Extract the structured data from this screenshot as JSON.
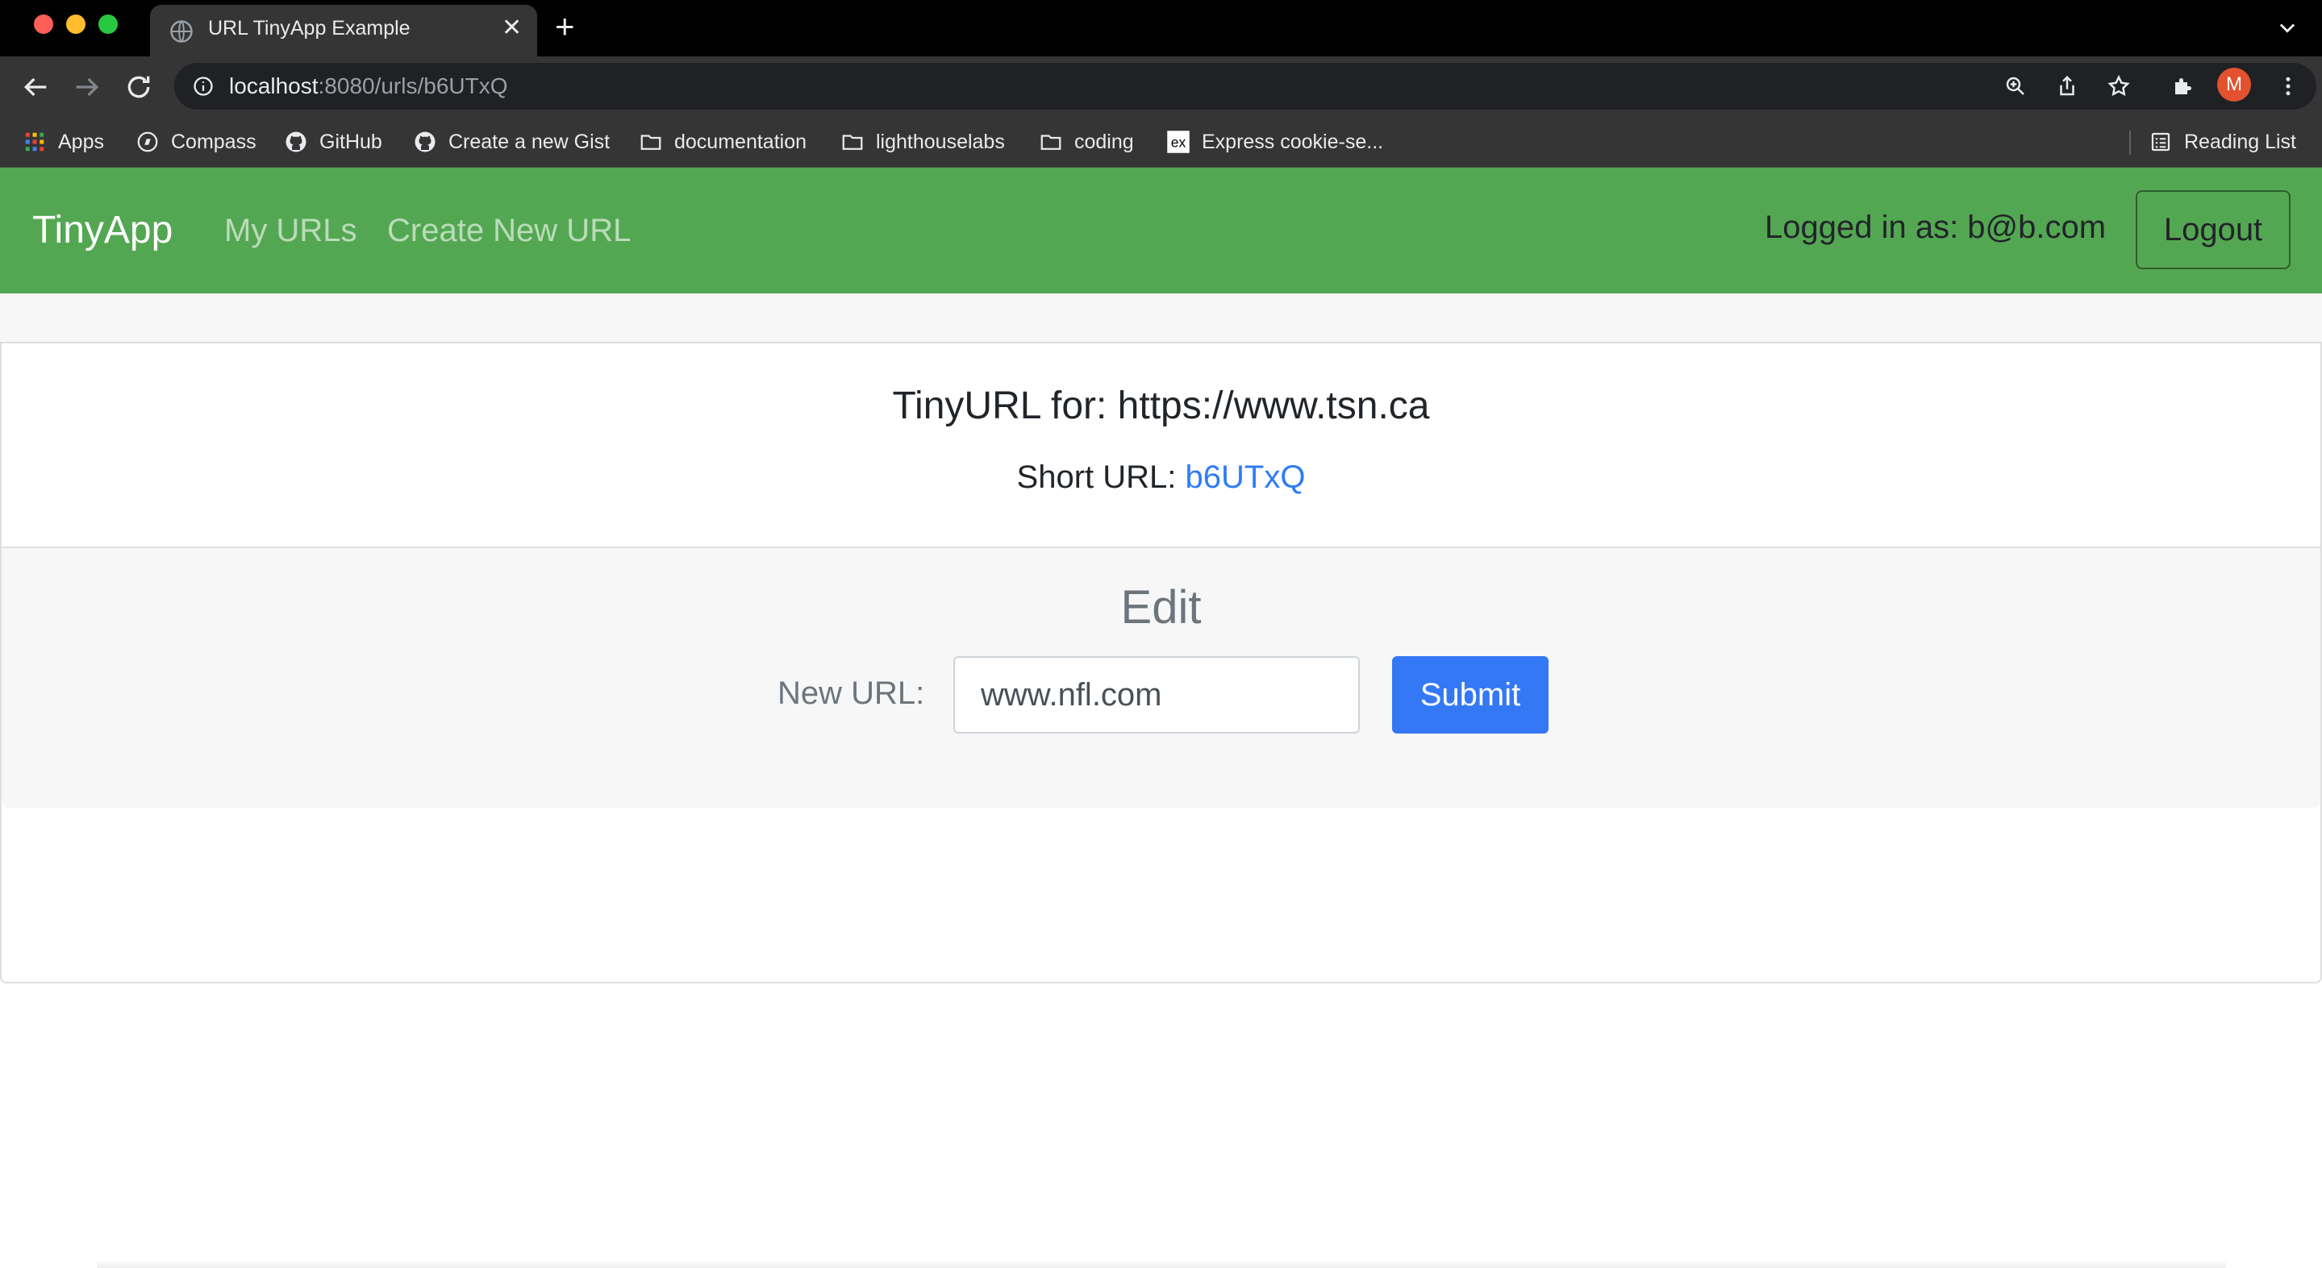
{
  "browser": {
    "tab_title": "URL TinyApp Example",
    "url_host": "localhost",
    "url_rest": ":8080/urls/b6UTxQ",
    "profile_initial": "M",
    "bookmarks": [
      "Apps",
      "Compass",
      "GitHub",
      "Create a new Gist",
      "documentation",
      "lighthouselabs",
      "coding",
      "Express cookie-se..."
    ],
    "reading_list": "Reading List"
  },
  "navbar": {
    "brand": "TinyApp",
    "links": [
      "My URLs",
      "Create New URL"
    ],
    "logged_in_text": "Logged in as: b@b.com",
    "logout_label": "Logout",
    "color": "#54a752"
  },
  "card": {
    "title": "TinyURL for: https://www.tsn.ca",
    "short_url_label": "Short URL: ",
    "short_url": "b6UTxQ"
  },
  "edit": {
    "heading": "Edit",
    "label": "New URL:",
    "input_value": "www.nfl.com",
    "submit_label": "Submit",
    "accent": "#3478f6"
  }
}
